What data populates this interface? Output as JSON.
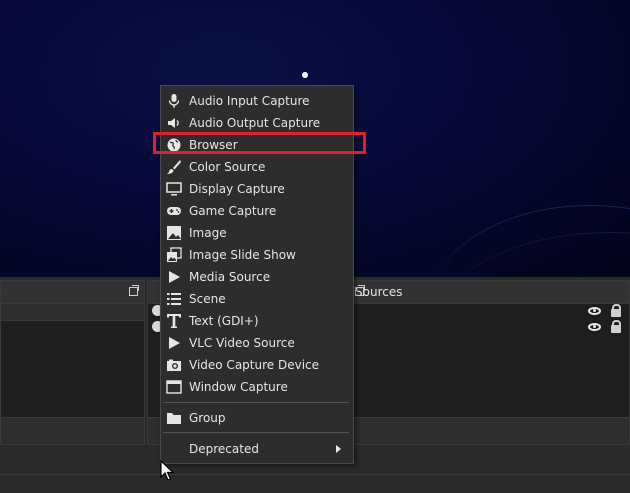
{
  "sources_dock": {
    "title": "Sources",
    "rows": 2
  },
  "context_menu": {
    "items": [
      {
        "label": "Audio Input Capture",
        "icon": "microphone-icon"
      },
      {
        "label": "Audio Output Capture",
        "icon": "speaker-icon"
      },
      {
        "label": "Browser",
        "icon": "globe-icon"
      },
      {
        "label": "Color Source",
        "icon": "paintbrush-icon"
      },
      {
        "label": "Display Capture",
        "icon": "monitor-icon"
      },
      {
        "label": "Game Capture",
        "icon": "gamepad-icon"
      },
      {
        "label": "Image",
        "icon": "image-icon"
      },
      {
        "label": "Image Slide Show",
        "icon": "slideshow-icon"
      },
      {
        "label": "Media Source",
        "icon": "play-icon"
      },
      {
        "label": "Scene",
        "icon": "list-icon"
      },
      {
        "label": "Text (GDI+)",
        "icon": "text-icon"
      },
      {
        "label": "VLC Video Source",
        "icon": "play-icon"
      },
      {
        "label": "Video Capture Device",
        "icon": "camera-icon"
      },
      {
        "label": "Window Capture",
        "icon": "window-icon"
      }
    ],
    "group": {
      "label": "Group",
      "icon": "folder-icon"
    },
    "deprecated": {
      "label": "Deprecated",
      "icon": "chevron-right-icon"
    }
  },
  "highlight_color": "#e0202b",
  "theme": {
    "menu_bg": "#2d2d2d",
    "text": "#e6e6e6",
    "preview_bg": "#06093a"
  }
}
